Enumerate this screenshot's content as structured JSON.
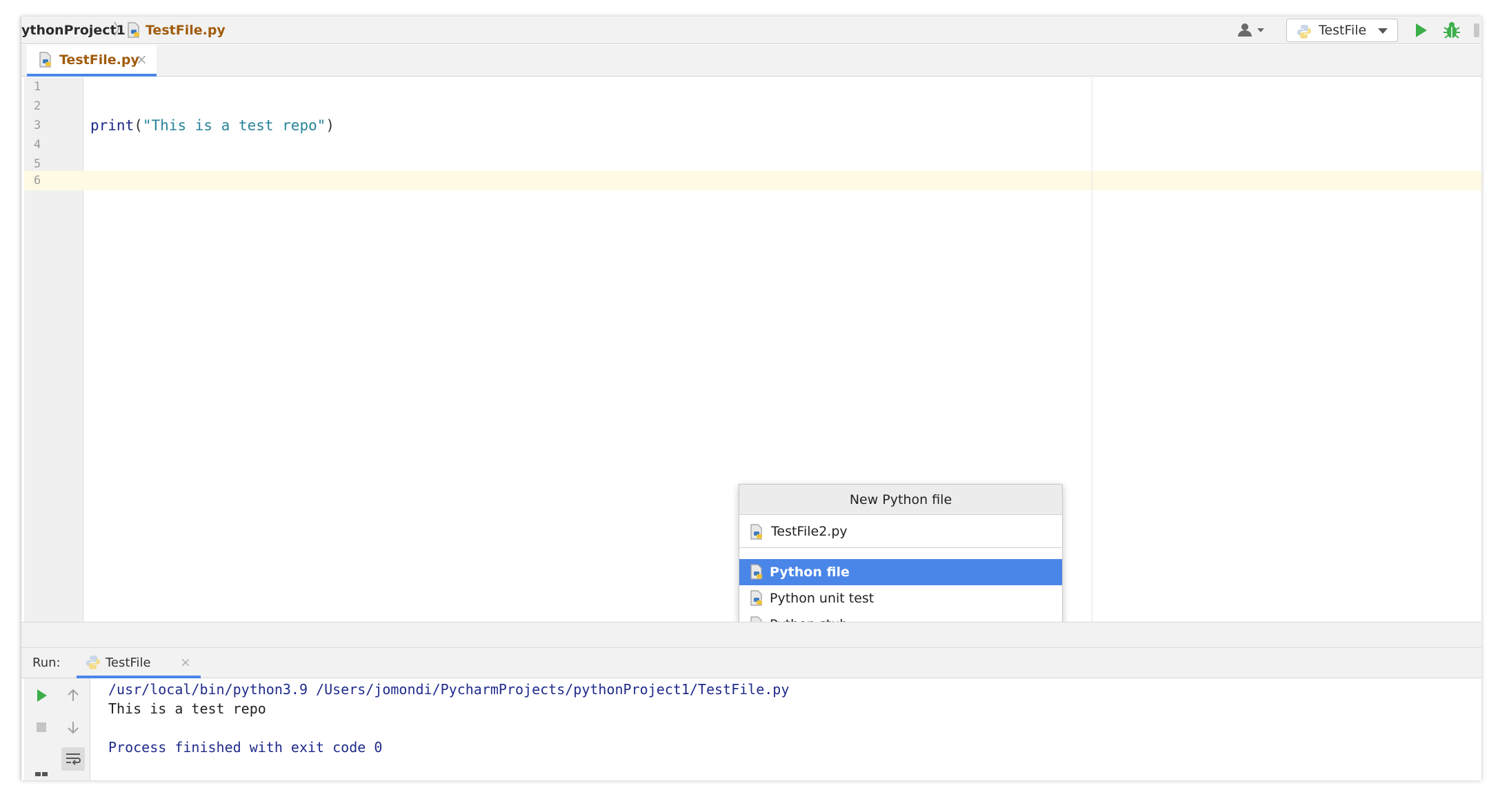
{
  "navbar": {
    "project_name": "ythonProject1",
    "separator": "〉",
    "file_name": "TestFile.py",
    "run_config_label": "TestFile"
  },
  "editor": {
    "tab_label": "TestFile.py",
    "tab_close": "×",
    "line_numbers": [
      "1",
      "2",
      "3",
      "4",
      "5",
      "6"
    ],
    "code": {
      "keyword": "print",
      "open_paren": "(",
      "string": "\"This is a test repo\"",
      "close_paren": ")"
    }
  },
  "popup": {
    "title": "New Python file",
    "input_value": "TestFile2.py",
    "options": [
      {
        "label": "Python file",
        "selected": true
      },
      {
        "label": "Python unit test",
        "selected": false
      },
      {
        "label": "Python stub",
        "selected": false
      }
    ]
  },
  "run": {
    "title": "Run:",
    "tab_label": "TestFile",
    "tab_close": "×",
    "console": {
      "command": "/usr/local/bin/python3.9 /Users/jomondi/PycharmProjects/pythonProject1/TestFile.py",
      "output": "This is a test repo",
      "exit": "Process finished with exit code 0"
    }
  },
  "colors": {
    "accent": "#4a86e8",
    "keyword": "#1f2a8a",
    "string": "#27839a",
    "file_tab_text": "#a15b0c",
    "run_green": "#3cae4a",
    "caret_line": "#fffae3"
  },
  "icons": [
    "python-file-icon",
    "user-icon",
    "python-logo-icon",
    "run-icon",
    "debug-icon",
    "stop-icon",
    "arrow-up-icon",
    "arrow-down-icon",
    "soft-wrap-icon",
    "layout-icon",
    "close-icon"
  ]
}
